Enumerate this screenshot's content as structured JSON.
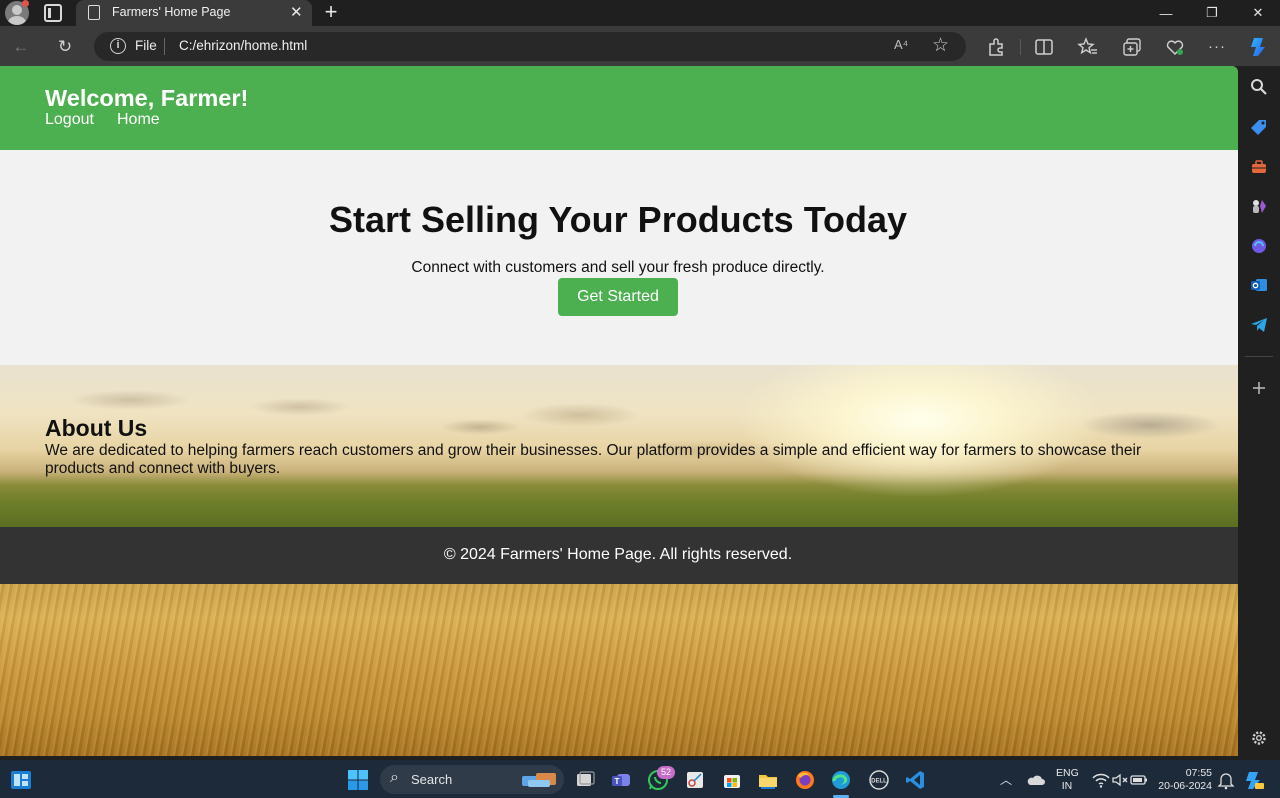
{
  "browser": {
    "tab_title": "Farmers' Home Page",
    "tab_close_glyph": "✕",
    "new_tab_glyph": "+",
    "address_scheme_label": "File",
    "url": "C:/ehrizon/home.html",
    "read_aloud_glyph": "A⁴",
    "window_controls": {
      "minimize": "—",
      "restore": "❐",
      "close": "✕"
    },
    "toolbar_glyphs": {
      "back": "←",
      "refresh": "↻",
      "more": "···"
    }
  },
  "site": {
    "header": {
      "welcome": "Welcome, Farmer!",
      "nav": {
        "logout": "Logout",
        "home": "Home"
      },
      "color": "#4caf50"
    },
    "hero": {
      "title": "Start Selling Your Products Today",
      "subtitle": "Connect with customers and sell your fresh produce directly.",
      "cta": "Get Started"
    },
    "about": {
      "title": "About Us",
      "text": "We are dedicated to helping farmers reach customers and grow their businesses. Our platform provides a simple and efficient way for farmers to showcase their products and connect with buyers."
    },
    "footer": {
      "text": "© 2024 Farmers' Home Page. All rights reserved.",
      "color": "#333333"
    }
  },
  "taskbar": {
    "search_label": "Search",
    "whatsapp_badge": "52",
    "language": {
      "line1": "ENG",
      "line2": "IN"
    },
    "clock": {
      "time": "07:55",
      "date": "20-06-2024"
    }
  }
}
